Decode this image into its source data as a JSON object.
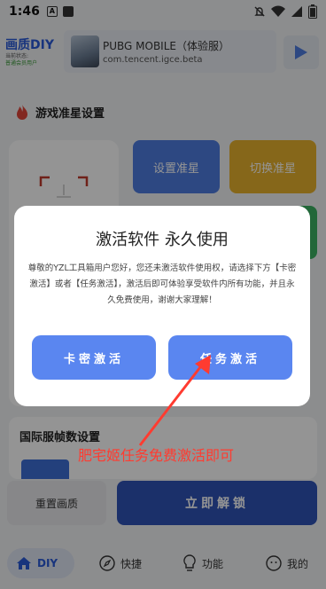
{
  "status_bar": {
    "time": "1:46",
    "icon_a": "A"
  },
  "header": {
    "brand": "画质DIY",
    "brand_sub1": "当前状态:",
    "brand_sub2": "普通会员用户",
    "game_title": "PUBG MOBILE（体验服）",
    "game_package": "com.tencent.igce.beta"
  },
  "section": {
    "title": "游戏准星设置"
  },
  "crosshair": {
    "set_label": "设置准星",
    "switch_label": "切换准星"
  },
  "intl": {
    "title": "国际服帧数设置"
  },
  "bottom_actions": {
    "reset": "重置画质",
    "unlock": "立即解锁"
  },
  "tabs": [
    {
      "label": "DIY",
      "icon": "home-icon"
    },
    {
      "label": "快捷",
      "icon": "compass-icon"
    },
    {
      "label": "功能",
      "icon": "bulb-icon"
    },
    {
      "label": "我的",
      "icon": "smile-icon"
    }
  ],
  "dialog": {
    "title": "激活软件 永久使用",
    "message": "尊敬的YZL工具箱用户您好，您还未激活软件使用权，请选择下方【卡密激活】或者【任务激活】，激活后即可体验享受软件内所有功能，并且永久免费使用，谢谢大家理解！",
    "card_key_label": "卡密激活",
    "task_label": "任务激活"
  },
  "annotation": {
    "text": "肥宅姬任务免费激活即可",
    "color": "#ff3b30"
  },
  "colors": {
    "accent": "#2a5bd7",
    "button": "#5a86f0",
    "gold": "#e7b22e",
    "green": "#3bb163"
  }
}
